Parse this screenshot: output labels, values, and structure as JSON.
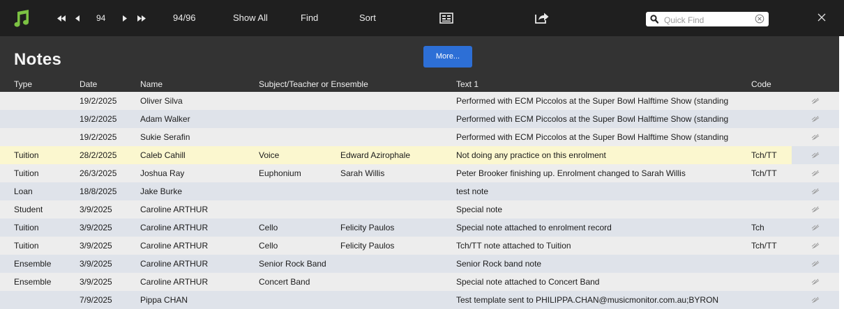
{
  "toolbar": {
    "app_icon": "music-note-icon",
    "record_current": "94",
    "record_position": "94/96",
    "show_all_label": "Show All",
    "find_label": "Find",
    "sort_label": "Sort",
    "form_view_icon": "list-view-icon",
    "share_icon": "share-icon",
    "quick_find_placeholder": "Quick Find",
    "close_icon": "close-icon"
  },
  "header": {
    "title": "Notes",
    "more_label": "More...",
    "columns": {
      "type": "Type",
      "date": "Date",
      "name": "Name",
      "subject": "Subject/Teacher or Ensemble",
      "text1": "Text 1",
      "code": "Code"
    }
  },
  "colors": {
    "toolbar_bg": "#1f1f1f",
    "header_bg": "#333333",
    "accent": "#2d6fd6",
    "app_icon": "#7cc243",
    "row_light": "#ededed",
    "row_blue": "#dfe3ea",
    "row_highlight": "#fbf7cf"
  },
  "rows": [
    {
      "type": "",
      "date": "19/2/2025",
      "name": "Oliver Silva",
      "subject": "",
      "teacher": "",
      "text": "Performed with ECM Piccolos at the Super Bowl Halftime Show (standing",
      "code": ""
    },
    {
      "type": "",
      "date": "19/2/2025",
      "name": "Adam Walker",
      "subject": "",
      "teacher": "",
      "text": "Performed with ECM Piccolos at the Super Bowl Halftime Show (standing",
      "code": ""
    },
    {
      "type": "",
      "date": "19/2/2025",
      "name": "Sukie Serafin",
      "subject": "",
      "teacher": "",
      "text": "Performed with ECM Piccolos at the Super Bowl Halftime Show (standing",
      "code": ""
    },
    {
      "type": "Tuition",
      "date": "28/2/2025",
      "name": "Caleb Cahill",
      "subject": "Voice",
      "teacher": "Edward Azirophale",
      "text": "Not doing any practice on this enrolment",
      "code": "Tch/TT"
    },
    {
      "type": "Tuition",
      "date": "26/3/2025",
      "name": "Joshua Ray",
      "subject": "Euphonium",
      "teacher": "Sarah Willis",
      "text": "Peter Brooker finishing up. Enrolment changed to Sarah Willis",
      "code": "Tch/TT"
    },
    {
      "type": "Loan",
      "date": "18/8/2025",
      "name": "Jake Burke",
      "subject": "",
      "teacher": "",
      "text": "test note",
      "code": ""
    },
    {
      "type": "Student",
      "date": "3/9/2025",
      "name": "Caroline ARTHUR",
      "subject": "",
      "teacher": "",
      "text": "Special note",
      "code": ""
    },
    {
      "type": "Tuition",
      "date": "3/9/2025",
      "name": "Caroline ARTHUR",
      "subject": "Cello",
      "teacher": "Felicity Paulos",
      "text": "Special note attached to enrolment record",
      "code": "Tch"
    },
    {
      "type": "Tuition",
      "date": "3/9/2025",
      "name": "Caroline ARTHUR",
      "subject": "Cello",
      "teacher": "Felicity Paulos",
      "text": "Tch/TT note attached to Tuition",
      "code": "Tch/TT"
    },
    {
      "type": "Ensemble",
      "date": "3/9/2025",
      "name": "Caroline ARTHUR",
      "subject": "Senior Rock Band",
      "teacher": "",
      "text": "Senior Rock band note",
      "code": ""
    },
    {
      "type": "Ensemble",
      "date": "3/9/2025",
      "name": "Caroline ARTHUR",
      "subject": "Concert Band",
      "teacher": "",
      "text": "Special note attached to Concert Band",
      "code": ""
    },
    {
      "type": "",
      "date": "7/9/2025",
      "name": "Pippa CHAN",
      "subject": "",
      "teacher": "",
      "text": "Test template sent to PHILIPPA.CHAN@musicmonitor.com.au;BYRON",
      "code": ""
    }
  ]
}
